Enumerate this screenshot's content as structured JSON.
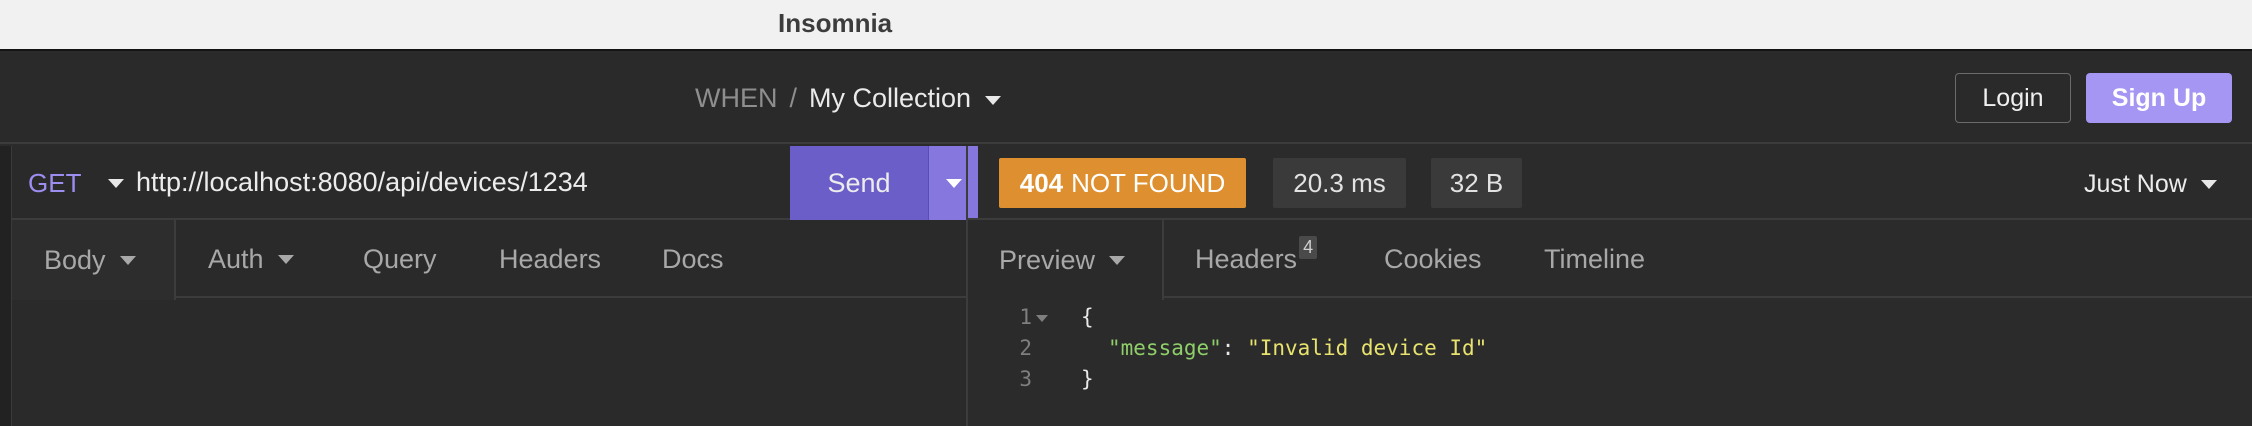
{
  "window": {
    "title": "Insomnia"
  },
  "header": {
    "workspace": "WHEN",
    "separator": "/",
    "collection": "My Collection",
    "login_label": "Login",
    "signup_label": "Sign Up"
  },
  "request": {
    "method": "GET",
    "url": "http://localhost:8080/api/devices/1234",
    "send_label": "Send",
    "tabs": [
      "Body",
      "Auth",
      "Query",
      "Headers",
      "Docs"
    ]
  },
  "response": {
    "status_code": "404",
    "status_text": "NOT FOUND",
    "time": "20.3 ms",
    "size": "32 B",
    "history": "Just Now",
    "tabs": [
      "Preview",
      "Headers",
      "Cookies",
      "Timeline"
    ],
    "headers_count": "4",
    "body_lines": [
      {
        "num": "1",
        "open": "{"
      },
      {
        "num": "2",
        "key": "\"message\"",
        "colon": ": ",
        "value": "\"Invalid device Id\""
      },
      {
        "num": "3",
        "close": "}"
      }
    ]
  },
  "colors": {
    "accent": "#a496f2",
    "send": "#6c5ec8",
    "status_404": "#de8f2f",
    "json_key": "#8fcf6a",
    "json_string": "#e8e26e"
  }
}
